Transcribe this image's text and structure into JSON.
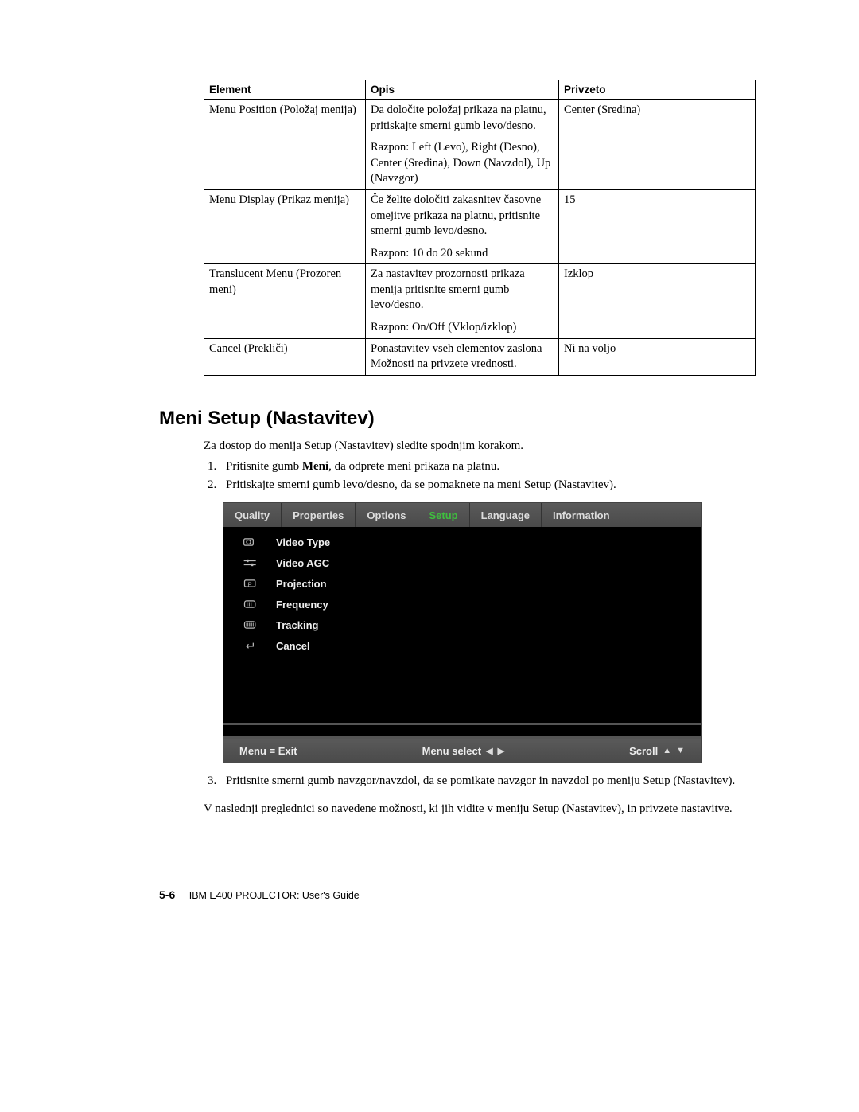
{
  "table": {
    "headers": [
      "Element",
      "Opis",
      "Privzeto"
    ],
    "rows": [
      {
        "element": "Menu Position (Položaj menija)",
        "opis_p1": "Da določite položaj prikaza na platnu, pritiskajte smerni gumb levo/desno.",
        "opis_p2": "Razpon: Left (Levo), Right (Desno), Center (Sredina), Down (Navzdol), Up (Navzgor)",
        "privzeto": "Center (Sredina)"
      },
      {
        "element": "Menu Display (Prikaz menija)",
        "opis_p1": "Če želite določiti zakasnitev časovne omejitve prikaza na platnu, pritisnite smerni gumb levo/desno.",
        "opis_p2": "Razpon: 10 do 20 sekund",
        "privzeto": "15"
      },
      {
        "element": "Translucent Menu (Prozoren meni)",
        "opis_p1": "Za nastavitev prozornosti prikaza menija pritisnite smerni gumb levo/desno.",
        "opis_p2": "Razpon: On/Off (Vklop/izklop)",
        "privzeto": "Izklop"
      },
      {
        "element": "Cancel (Prekliči)",
        "opis_p1": "Ponastavitev vseh elementov zaslona Možnosti na privzete vrednosti.",
        "opis_p2": "",
        "privzeto": "Ni na voljo"
      }
    ]
  },
  "section_title": "Meni Setup (Nastavitev)",
  "intro": "Za dostop do menija Setup (Nastavitev) sledite spodnjim korakom.",
  "steps": {
    "s1a": "Pritisnite gumb ",
    "s1b": "Meni",
    "s1c": ", da odprete meni prikaza na platnu.",
    "s2": "Pritiskajte smerni gumb levo/desno, da se pomaknete na meni Setup (Nastavitev).",
    "s3": "Pritisnite smerni gumb navzgor/navzdol, da se pomikate navzgor in navzdol po meniju Setup (Nastavitev)."
  },
  "after": "V naslednji preglednici so navedene možnosti, ki jih vidite v meniju Setup (Nastavitev), in privzete nastavitve.",
  "osd": {
    "tabs": [
      "Quality",
      "Properties",
      "Options",
      "Setup",
      "Language",
      "Information"
    ],
    "active_tab": "Setup",
    "items": [
      "Video Type",
      "Video AGC",
      "Projection",
      "Frequency",
      "Tracking",
      "Cancel"
    ],
    "footer": {
      "exit": "Menu = Exit",
      "select": "Menu select",
      "scroll": "Scroll"
    }
  },
  "footer": {
    "page": "5-6",
    "book": "IBM E400 PROJECTOR: User's Guide"
  }
}
